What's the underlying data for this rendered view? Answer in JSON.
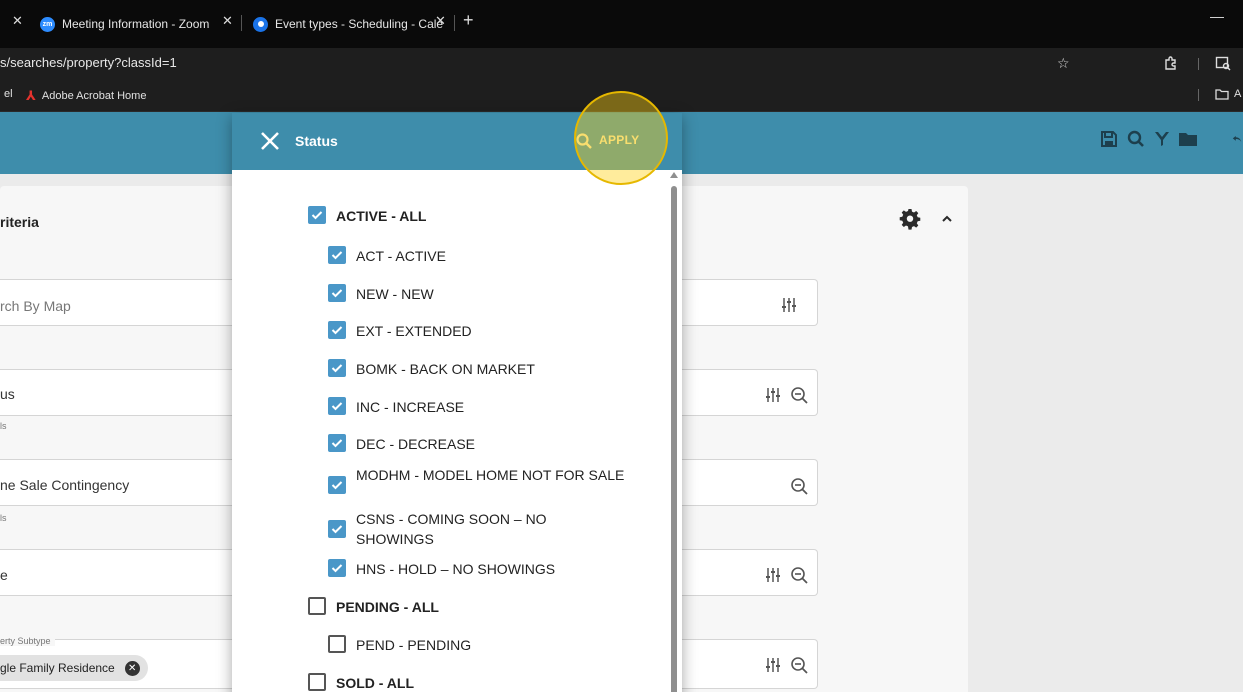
{
  "browser": {
    "tabs": [
      {
        "label": "Meeting Information - Zoom",
        "icon": "zoom-favicon",
        "favicon_text": "zm"
      },
      {
        "label": "Event types - Scheduling - Cale",
        "icon": "calendly-favicon"
      }
    ],
    "address": "s/searches/property?classId=1",
    "bookmarks": [
      {
        "label": "el"
      },
      {
        "label": "Adobe Acrobat Home",
        "icon": "acrobat-icon"
      }
    ],
    "folder_label": "A"
  },
  "background": {
    "card_title": "riteria",
    "fields": [
      {
        "text": "rch By Map",
        "sub": "",
        "icons": [
          "filter-sliders-icon"
        ]
      },
      {
        "text": "us",
        "sub": "ls",
        "icons": [
          "filter-sliders-icon",
          "zoom-out-icon"
        ]
      },
      {
        "text": "ne Sale Contingency",
        "sub": "ls",
        "icons": [
          "zoom-out-icon"
        ]
      },
      {
        "text": "e",
        "sub": "",
        "icons": [
          "filter-sliders-icon",
          "zoom-out-icon"
        ]
      },
      {
        "text": "",
        "sub": "",
        "icons": [
          "filter-sliders-icon",
          "zoom-out-icon"
        ]
      }
    ],
    "subtype_label": "erty Subtype",
    "subtype_chip": "gle Family Residence"
  },
  "modal": {
    "title": "Status",
    "apply_label": "APPLY",
    "options": [
      {
        "label": "ACTIVE - ALL",
        "checked": true,
        "group": true
      },
      {
        "label": "ACT - ACTIVE",
        "checked": true,
        "group": false
      },
      {
        "label": "NEW - NEW",
        "checked": true,
        "group": false
      },
      {
        "label": "EXT - EXTENDED",
        "checked": true,
        "group": false
      },
      {
        "label": "BOMK - BACK ON MARKET",
        "checked": true,
        "group": false
      },
      {
        "label": "INC - INCREASE",
        "checked": true,
        "group": false
      },
      {
        "label": "DEC - DECREASE",
        "checked": true,
        "group": false
      },
      {
        "label": "MODHM - MODEL HOME NOT FOR SALE",
        "checked": true,
        "group": false
      },
      {
        "label": "CSNS - COMING SOON – NO SHOWINGS",
        "checked": true,
        "group": false
      },
      {
        "label": "HNS - HOLD – NO SHOWINGS",
        "checked": true,
        "group": false
      },
      {
        "label": "PENDING - ALL",
        "checked": false,
        "group": true
      },
      {
        "label": "PEND - PENDING",
        "checked": false,
        "group": false
      },
      {
        "label": "SOLD - ALL",
        "checked": false,
        "group": true
      }
    ]
  },
  "colors": {
    "header": "#3e8dab",
    "checkbox": "#4a97c8",
    "highlight": "#e6b800"
  }
}
